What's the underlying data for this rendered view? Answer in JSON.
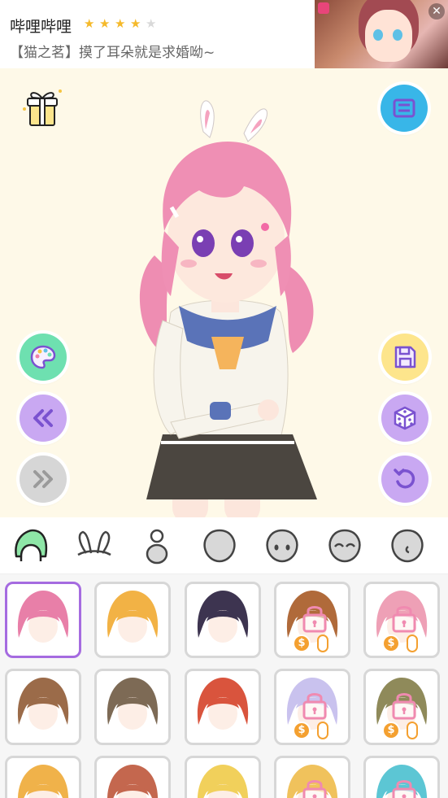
{
  "ad": {
    "title": "哔哩哔哩",
    "rating": 4,
    "max_rating": 5,
    "subtitle": "【猫之茗】摸了耳朵就是求婚呦~",
    "close_label": "✕"
  },
  "stage": {
    "background": "#fef9e8",
    "buttons": {
      "gift": "gift-icon",
      "outfit_menu": "outfit-list-icon",
      "palette": "palette-icon",
      "undo_back": "double-left-icon",
      "redo_forward": "double-right-icon",
      "save": "save-icon",
      "random": "dice-icon",
      "reset": "reset-icon"
    }
  },
  "categories": [
    {
      "id": "hair",
      "icon": "hair-icon",
      "selected": true
    },
    {
      "id": "ears",
      "icon": "animal-ears-icon",
      "selected": false
    },
    {
      "id": "body",
      "icon": "body-icon",
      "selected": false
    },
    {
      "id": "head",
      "icon": "head-icon",
      "selected": false
    },
    {
      "id": "eyes",
      "icon": "eyes-icon",
      "selected": false
    },
    {
      "id": "eyebrows",
      "icon": "closed-eyes-icon",
      "selected": false
    },
    {
      "id": "mouth",
      "icon": "mouth-icon",
      "selected": false
    }
  ],
  "hair_items": [
    {
      "color": "#e87fa8",
      "locked": false,
      "selected": true,
      "coin_label": ""
    },
    {
      "color": "#f2b245",
      "locked": false,
      "selected": false,
      "coin_label": ""
    },
    {
      "color": "#3d3450",
      "locked": false,
      "selected": false,
      "coin_label": ""
    },
    {
      "color": "#b06a3a",
      "locked": true,
      "selected": false,
      "coin_label": "$"
    },
    {
      "color": "#eea0b6",
      "locked": true,
      "selected": false,
      "coin_label": "$"
    },
    {
      "color": "#9b6b49",
      "locked": false,
      "selected": false,
      "coin_label": ""
    },
    {
      "color": "#7d6a55",
      "locked": false,
      "selected": false,
      "coin_label": ""
    },
    {
      "color": "#d9543d",
      "locked": false,
      "selected": false,
      "coin_label": ""
    },
    {
      "color": "#c9c2ee",
      "locked": true,
      "selected": false,
      "coin_label": "$"
    },
    {
      "color": "#8f8a5a",
      "locked": true,
      "selected": false,
      "coin_label": "$"
    },
    {
      "color": "#f0b24a",
      "locked": false,
      "selected": false,
      "coin_label": ""
    },
    {
      "color": "#c4674e",
      "locked": false,
      "selected": false,
      "coin_label": ""
    },
    {
      "color": "#f1d05b",
      "locked": false,
      "selected": false,
      "coin_label": ""
    },
    {
      "color": "#f0c25c",
      "locked": true,
      "selected": false,
      "coin_label": ""
    },
    {
      "color": "#5cc6d4",
      "locked": true,
      "selected": false,
      "coin_label": ""
    }
  ],
  "colors": {
    "accent_purple": "#a56be0",
    "button_green": "#6ee0b0",
    "button_purple": "#c9a8f2",
    "button_yellow": "#fde58c",
    "button_gray": "#d6d6d6",
    "lock_pink": "#f08ab0",
    "coin_orange": "#f4a030"
  }
}
